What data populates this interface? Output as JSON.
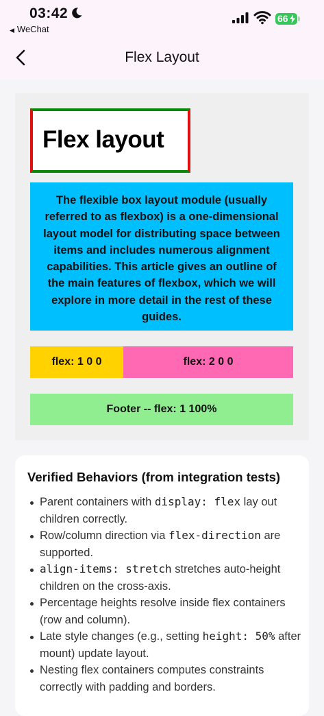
{
  "status": {
    "time": "03:42",
    "back_app": "WeChat",
    "battery": "66"
  },
  "nav": {
    "title": "Flex Layout"
  },
  "demo": {
    "heading": "Flex layout",
    "description": "The flexible box layout module (usually referred to as flexbox) is a one-dimensional layout model for distributing space between items and includes numerous alignment capabilities. This article gives an outline of the main features of flexbox, which we will explore in more detail in the rest of these guides.",
    "row": {
      "cell1": "flex: 1 0 0",
      "cell2": "flex: 2 0 0"
    },
    "footer": "Footer -- flex: 1 100%"
  },
  "card": {
    "title": "Verified Behaviors (from integration tests)",
    "items": [
      {
        "before": "Parent containers with ",
        "code": "display: flex",
        "after": " lay out children correctly."
      },
      {
        "before": "Row/column direction via ",
        "code": "flex-direction",
        "after": " are supported."
      },
      {
        "before": "",
        "code": "align-items: stretch",
        "after": " stretches auto-height children on the cross-axis."
      },
      {
        "before": "Percentage heights resolve inside flex containers (row and column).",
        "code": "",
        "after": ""
      },
      {
        "before": "Late style changes (e.g., setting ",
        "code": "height: 50%",
        "after": " after mount) update layout."
      },
      {
        "before": "Nesting flex containers computes constraints correctly with padding and borders.",
        "code": "",
        "after": ""
      }
    ]
  },
  "colors": {
    "title_border_h": "#0a8a0a",
    "title_border_v": "#e01010",
    "description_bg": "#00bfff",
    "cell1_bg": "#ffd200",
    "cell2_bg": "#ff69b4",
    "footer_bg": "#90ee90",
    "battery": "#35c759"
  },
  "icons": [
    "moon-icon",
    "signal-icon",
    "wifi-icon",
    "battery-icon",
    "back-chevron-icon"
  ]
}
